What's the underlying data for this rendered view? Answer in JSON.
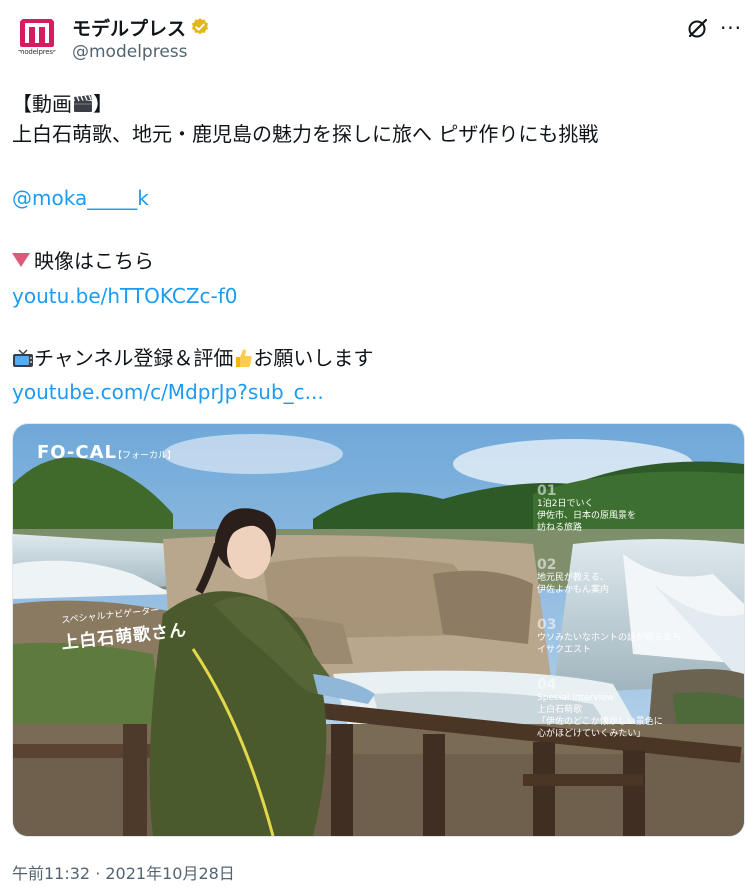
{
  "account": {
    "display_name": "モデルプレス",
    "handle": "@modelpress",
    "avatar_text": "modelpress",
    "brand_color": "#d81b60",
    "verified_color": "#e2b719"
  },
  "icons": {
    "grok": "grok-icon",
    "more": "more-icon",
    "more_glyph": "···"
  },
  "tweet": {
    "line1": "【動画",
    "line1_end": "】",
    "line2": "上白石萌歌、地元・鹿児島の魅力を探しに旅へ ピザ作りにも挑戦",
    "mention": "@moka_____k",
    "video_label": "映像はこちら",
    "video_link": "youtu.be/hTTOKCZc-f0",
    "channel_text_1": "チャンネル登録＆評価",
    "channel_text_2": "お願いします",
    "channel_link": "youtube.com/c/MdprJp?sub_c..."
  },
  "media": {
    "title": "FO-CAL",
    "title_sub": "【フォーカル】",
    "navigator_label": "スペシャルナビゲーター",
    "navigator_name": "上白石萌歌さん",
    "items": [
      {
        "num": "01",
        "lines": [
          "1泊2日でいく",
          "伊佐市、日本の原風景を",
          "訪ねる旅路"
        ]
      },
      {
        "num": "02",
        "lines": [
          "地元民が教える、",
          "伊佐よかもん案内"
        ]
      },
      {
        "num": "03",
        "lines": [
          "ウソみたいなホントの話が眠るまち",
          "イサクエスト"
        ]
      },
      {
        "num": "04",
        "lines": [
          "Special interview",
          "上白石萌歌",
          "「伊佐のどこか懐かしい景色に",
          "心がほどけていくみたい」"
        ]
      }
    ]
  },
  "timestamp": "午前11:32 · 2021年10月28日",
  "colors": {
    "link": "#1d9bf0",
    "text": "#0f1419",
    "muted": "#536471"
  }
}
